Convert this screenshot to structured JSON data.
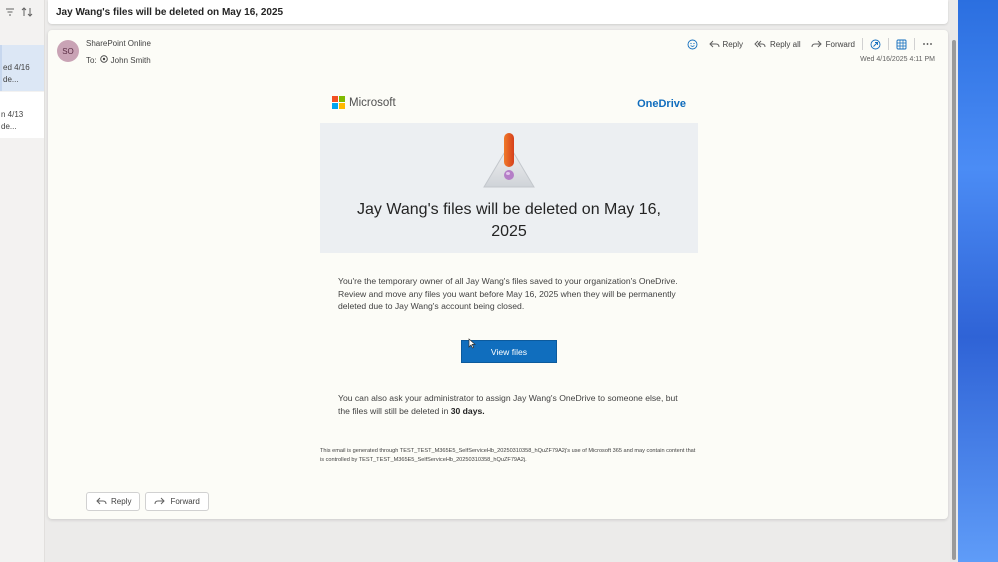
{
  "list": {
    "item1_line1": "ed 4/16",
    "item1_line2": "de...",
    "item2_line1": "n 4/13",
    "item2_line2": "de..."
  },
  "subject": "Jay Wang's files will be deleted on May 16, 2025",
  "header": {
    "avatar_initials": "SO",
    "sender": "SharePoint Online",
    "to_label": "To:",
    "recipient": "John Smith",
    "time": "Wed 4/16/2025 4:11 PM",
    "reply": "Reply",
    "reply_all": "Reply all",
    "forward": "Forward"
  },
  "email": {
    "brand_left": "Microsoft",
    "brand_right": "OneDrive",
    "hero_title": "Jay Wang's files will be deleted on May 16, 2025",
    "paragraph": "You're the temporary owner of all Jay Wang's files saved to your organization's OneDrive. Review and move any files you want before May 16, 2025 when they will be permanently deleted due to Jay Wang's account being closed.",
    "button": "View files",
    "secondary_text": "You can also ask your administrator to assign Jay Wang's OneDrive to someone else, but the files will still be deleted in ",
    "secondary_bold": "30 days.",
    "disclaimer": "This email is generated through TEST_TEST_M365E5_SelfServiceHb_20250310358_hQuZF79A2j's use of Microsoft 365 and may contain content that is controlled by TEST_TEST_M365E5_SelfServiceHb_20250310358_hQuZF79A2j."
  },
  "bottom": {
    "reply": "Reply",
    "forward": "Forward"
  },
  "colors": {
    "accent": "#0f6cbd",
    "button": "#106ebe",
    "avatar": "#c9a3b5"
  },
  "icons": [
    "filter-icon",
    "sort-icon",
    "emoji-icon",
    "reply-icon",
    "reply-all-icon",
    "forward-icon",
    "loop-icon",
    "apps-grid-icon",
    "more-icon",
    "contact-icon",
    "warning-icon",
    "microsoft-logo"
  ]
}
